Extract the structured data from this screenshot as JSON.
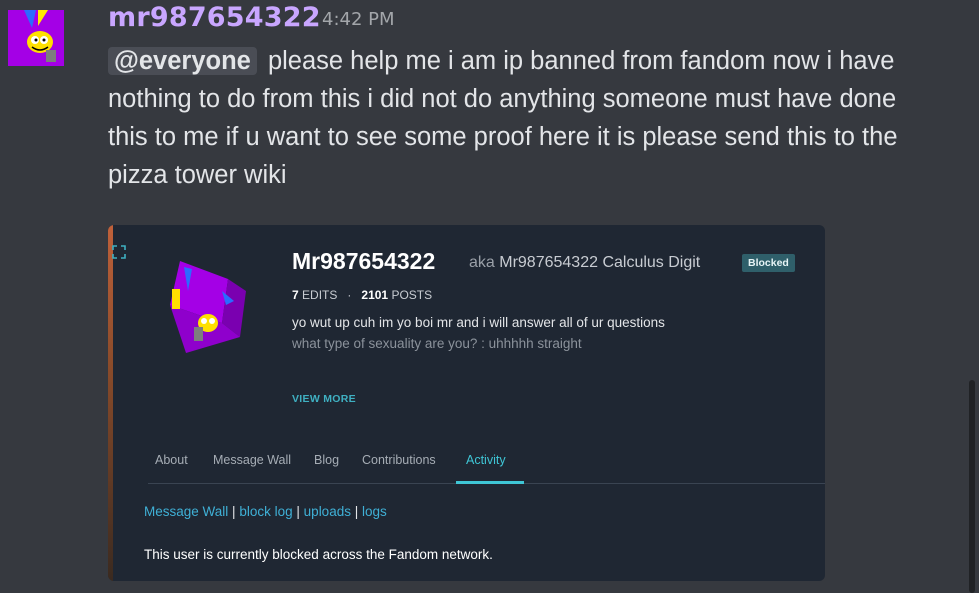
{
  "message": {
    "username": "mr987654322",
    "timestamp": "4:42 PM",
    "mention": "@everyone",
    "text": "please help me i am ip banned from fandom now i have nothing to do from this i did not do anything someone must have done this to me if u want to see some proof here it is please send this to the pizza tower wiki"
  },
  "embed": {
    "profile_name": "Mr987654322",
    "aka_word": "aka",
    "aka_name": "Mr987654322 Calculus Digit",
    "badge": "Blocked",
    "edits_count": "7",
    "edits_label": "EDITS",
    "stats_sep": "·",
    "posts_count": "2101",
    "posts_label": "POSTS",
    "bio_line1": "yo wut up cuh im yo boi mr and i will answer all of ur questions",
    "bio_line2": "what type of sexuality are you? : uhhhhh straight",
    "view_more": "VIEW MORE",
    "tabs": [
      "About",
      "Message Wall",
      "Blog",
      "Contributions",
      "Activity"
    ],
    "active_tab": "Activity",
    "links": [
      "Message Wall",
      "block log",
      "uploads",
      "logs"
    ],
    "link_sep": "|",
    "blocked_notice": "This user is currently blocked across the Fandom network."
  },
  "colors": {
    "background": "#36393f",
    "username": "#c9a6ff",
    "accent": "#3fc6d6"
  },
  "icons": [
    "avatar-image",
    "expand-icon",
    "profile-cube-image"
  ]
}
